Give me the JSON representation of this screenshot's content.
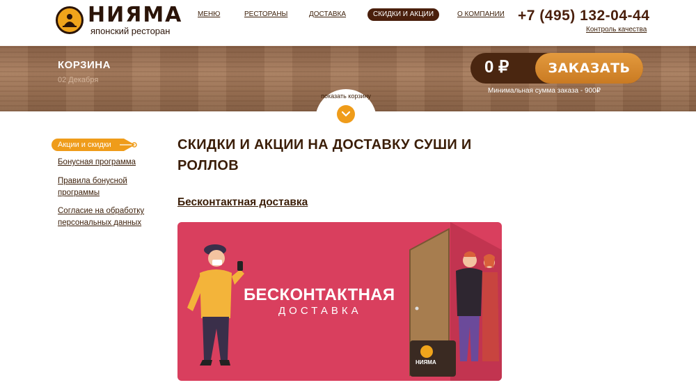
{
  "header": {
    "logo_name": "НИЯМА",
    "logo_subtitle": "японский ресторан",
    "nav": [
      "МЕНЮ",
      "РЕСТОРАНЫ",
      "ДОСТАВКА",
      "СКИДКИ И АКЦИИ",
      "О КОМПАНИИ"
    ],
    "active_nav": "СКИДКИ И АКЦИИ",
    "phone": "+7 (495) 132-04-44",
    "quality_link": "Контроль качества"
  },
  "banner": {
    "title": "КОРЗИНА",
    "date": "02 Декабря",
    "order_sum": "0 ₽",
    "order_button": "ЗАКАЗАТЬ",
    "min_sum": "Минимальная сумма заказа - 900₽",
    "show_cart": "показать корзину"
  },
  "sidebar": {
    "active_item": "Акции и скидки",
    "items": [
      "Бонусная программа",
      "Правила бонусной программы",
      "Согласие на обработку персональных данных"
    ]
  },
  "main": {
    "title": "СКИДКИ И АКЦИИ НА ДОСТАВКУ СУШИ И РОЛЛОВ",
    "promo_link": "Бесконтактная доставка",
    "promo_image_title": "БЕСКОНТАКТНАЯ",
    "promo_image_subtitle": "ДОСТАВКА",
    "promo_bag_label": "НИЯМА"
  },
  "colors": {
    "brand_brown": "#4a1f0c",
    "accent_orange": "#ef9c1a",
    "promo_red": "#d93f5e"
  }
}
